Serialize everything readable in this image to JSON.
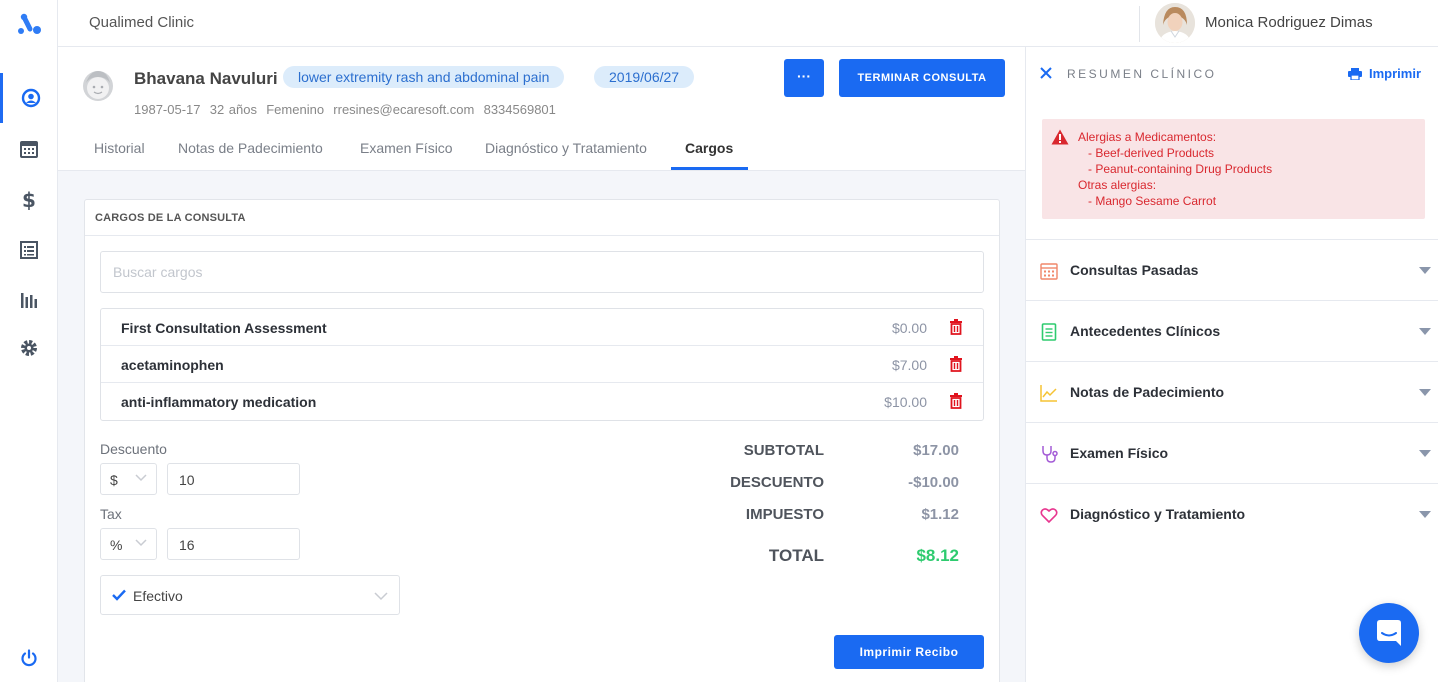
{
  "topbar": {
    "clinic": "Qualimed Clinic",
    "user_name": "Monica Rodriguez Dimas"
  },
  "nav": {
    "items": [
      "profile-icon",
      "calendar-icon",
      "dollar-icon",
      "list-icon",
      "bar-chart-icon",
      "gear-icon"
    ],
    "bottom": "power-icon"
  },
  "patient": {
    "name": "Bhavana Navuluri",
    "reason": "lower extremity rash and abdominal pain",
    "date": "2019/06/27",
    "birthdate": "1987-05-17",
    "age": "32 años",
    "sex": "Femenino",
    "email": "rresines@ecaresoft.com",
    "phone": "8334569801"
  },
  "actions": {
    "more_label": "···",
    "end_label": "TERMINAR CONSULTA"
  },
  "tabs": [
    "Historial",
    "Notas de Padecimiento",
    "Examen Físico",
    "Diagnóstico y Tratamiento",
    "Cargos"
  ],
  "charges": {
    "title": "CARGOS DE LA CONSULTA",
    "search_placeholder": "Buscar cargos",
    "items": [
      {
        "name": "First Consultation Assessment",
        "price": "$0.00"
      },
      {
        "name": "acetaminophen",
        "price": "$7.00"
      },
      {
        "name": "anti-inflammatory medication",
        "price": "$10.00"
      }
    ],
    "discount_label": "Descuento",
    "discount_unit": "$",
    "discount_value": "10",
    "tax_label": "Tax",
    "tax_unit": "%",
    "tax_value": "16",
    "payment_method": "Efectivo",
    "subtotal_label": "SUBTOTAL",
    "subtotal": "$17.00",
    "discount_total_label": "DESCUENTO",
    "discount_total": "-$10.00",
    "tax_total_label": "IMPUESTO",
    "tax_total": "$1.12",
    "total_label": "TOTAL",
    "total": "$8.12",
    "print_receipt_label": "Imprimir Recibo"
  },
  "summary": {
    "title": "RESUMEN CLÍNICO",
    "print_label": "Imprimir",
    "alert_lines": [
      "Alergias a Medicamentos:",
      "- Beef-derived Products",
      "- Peanut-containing Drug Products",
      "Otras alergias:",
      "- Mango Sesame Carrot"
    ],
    "sections": [
      {
        "label": "Consultas Pasadas",
        "icon": "calendar-icon",
        "color": "#f0876a"
      },
      {
        "label": "Antecedentes Clínicos",
        "icon": "document-icon",
        "color": "#2ecb6f"
      },
      {
        "label": "Notas de Padecimiento",
        "icon": "line-chart-icon",
        "color": "#f5c334"
      },
      {
        "label": "Examen Físico",
        "icon": "stethoscope-icon",
        "color": "#a35bd6"
      },
      {
        "label": "Diagnóstico y Tratamiento",
        "icon": "heart-icon",
        "color": "#e8368f"
      }
    ]
  },
  "colors": {
    "accent": "#1a6af2",
    "alert": "#d9282f",
    "total": "#2ecb6f"
  }
}
